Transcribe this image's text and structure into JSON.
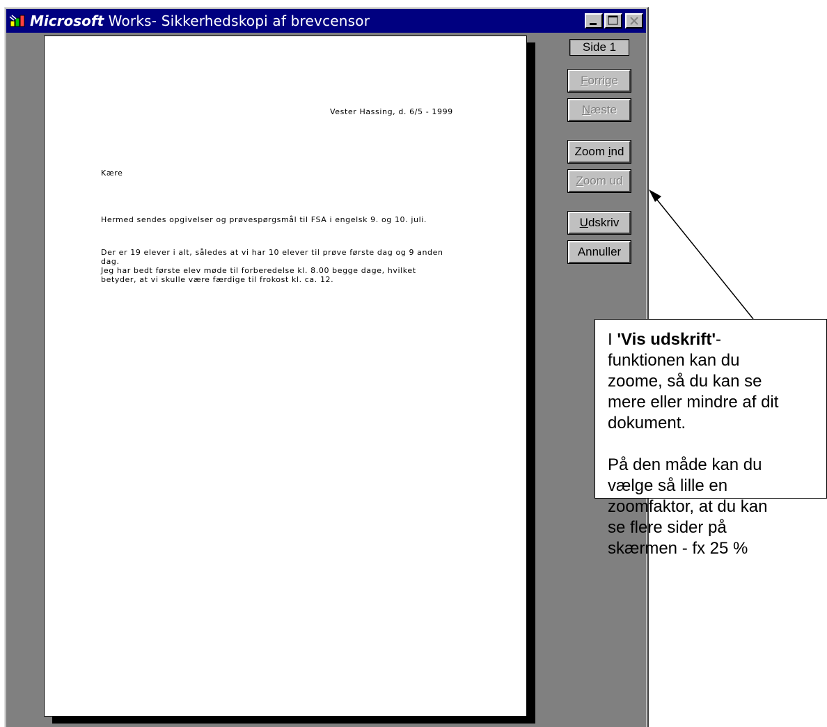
{
  "window": {
    "title_brand": "Microsoft",
    "title_rest": " Works- Sikkerhedskopi af brevcensor",
    "controls": {
      "minimize": "minimize-icon",
      "maximize": "maximize-icon",
      "close": "close-icon"
    }
  },
  "document": {
    "date_line": "Vester Hassing, d. 6/5 - 1999",
    "greeting": "Kære",
    "paragraph1": "Hermed sendes opgivelser og prøvespørgsmål til FSA i engelsk 9. og 10. juli.",
    "paragraph2_lines": [
      "Der er 19 elever i alt, således at vi har 10 elever til prøve første dag og 9 anden",
      "dag.",
      "Jeg har bedt første elev møde til forberedelse kl. 8.00 begge dage, hvilket",
      "betyder, at vi skulle være færdige til frokost kl. ca. 12."
    ]
  },
  "toolbar": {
    "page_indicator": "Side 1",
    "buttons": {
      "forrige": {
        "hotkey": "F",
        "rest": "orrige"
      },
      "naeste": {
        "hotkey": "N",
        "rest": "æste"
      },
      "zoom_ind": {
        "before": "Zoom ",
        "hotkey": "i",
        "after": "nd"
      },
      "zoom_ud": {
        "hotkey": "Z",
        "rest": "oom ud"
      },
      "udskriv": {
        "hotkey": "U",
        "rest": "dskriv"
      },
      "annuller": "Annuller"
    }
  },
  "callout": {
    "line1_prefix": "I ",
    "line1_bold": "'Vis udskrift'",
    "line1_suffix": "-",
    "lines_a": [
      "funktionen kan du",
      "zoome, så du kan se",
      "mere eller mindre af dit",
      "dokument."
    ],
    "lines_b": [
      "På den måde kan du",
      "vælge så lille en",
      "zoomfaktor, at du kan",
      "se flere sider på",
      "skærmen - fx 25 %"
    ]
  },
  "colors": {
    "titlebar": "#000080",
    "face": "#c0c0c0",
    "workspace": "#808080"
  }
}
